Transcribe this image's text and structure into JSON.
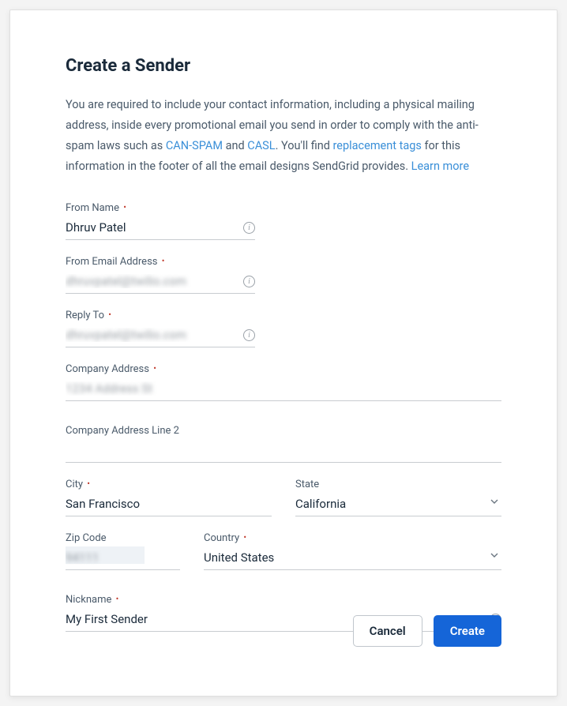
{
  "title": "Create a Sender",
  "description": {
    "pre": "You are required to include your contact information, including a physical mailing address, inside every promotional email you send in order to comply with the anti-spam laws such as ",
    "link_canspam": "CAN-SPAM",
    "mid1": " and ",
    "link_casl": "CASL",
    "mid2": ". You'll find ",
    "link_tags": "replacement tags",
    "mid3": " for this information in the footer of all the email designs SendGrid provides. ",
    "link_learn": "Learn more"
  },
  "fields": {
    "from_name": {
      "label": "From Name",
      "value": "Dhruv Patel",
      "required": true
    },
    "from_email": {
      "label": "From Email Address",
      "value": "dhruvpatel@twilio.com",
      "required": true
    },
    "reply_to": {
      "label": "Reply To",
      "value": "dhruvpatel@twilio.com",
      "required": true
    },
    "address1": {
      "label": "Company Address",
      "value": "1234 Address St",
      "required": true
    },
    "address2": {
      "label": "Company Address Line 2",
      "value": "",
      "required": false
    },
    "city": {
      "label": "City",
      "value": "San Francisco",
      "required": true
    },
    "state": {
      "label": "State",
      "value": "California",
      "required": false
    },
    "zip": {
      "label": "Zip Code",
      "value": "94111",
      "required": false
    },
    "country": {
      "label": "Country",
      "value": "United States",
      "required": true
    },
    "nickname": {
      "label": "Nickname",
      "value": "My First Sender",
      "required": true
    }
  },
  "buttons": {
    "cancel": "Cancel",
    "create": "Create"
  },
  "required_marker": "•"
}
